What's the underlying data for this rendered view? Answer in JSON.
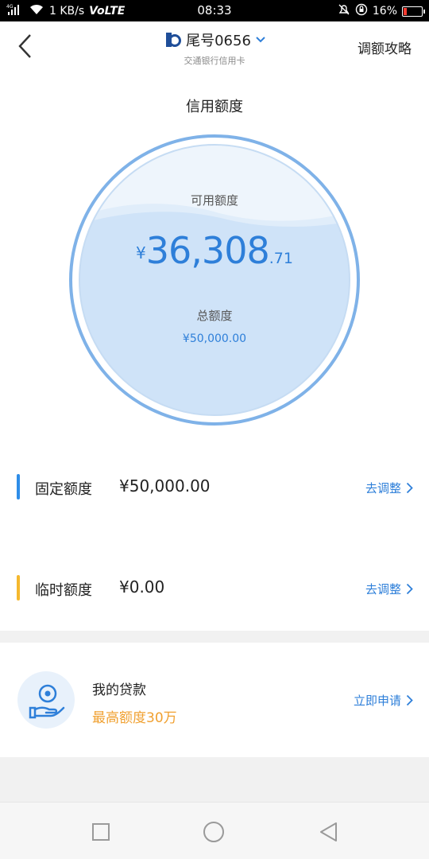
{
  "status_bar": {
    "network": "4G",
    "speed": "1 KB/s",
    "volte": "VoLTE",
    "time": "08:33",
    "battery": "16%"
  },
  "header": {
    "card_name": "尾号0656",
    "card_sub": "交通银行信用卡",
    "strategy": "调额攻略"
  },
  "section_title": "信用额度",
  "gauge": {
    "available_label": "可用额度",
    "currency": "¥",
    "available_int": "36,308",
    "available_dec": ".71",
    "total_label": "总额度",
    "total_value": "¥50,000.00"
  },
  "limits": [
    {
      "name": "固定额度",
      "value": "¥50,000.00",
      "action": "去调整",
      "color": "#2e8de8"
    },
    {
      "name": "临时额度",
      "value": "¥0.00",
      "action": "去调整",
      "color": "#f5b82e"
    }
  ],
  "loan": {
    "title": "我的贷款",
    "subtitle": "最高额度30万",
    "action": "立即申请"
  },
  "colors": {
    "accent": "#2e7fd9",
    "orange": "#f0a030"
  }
}
